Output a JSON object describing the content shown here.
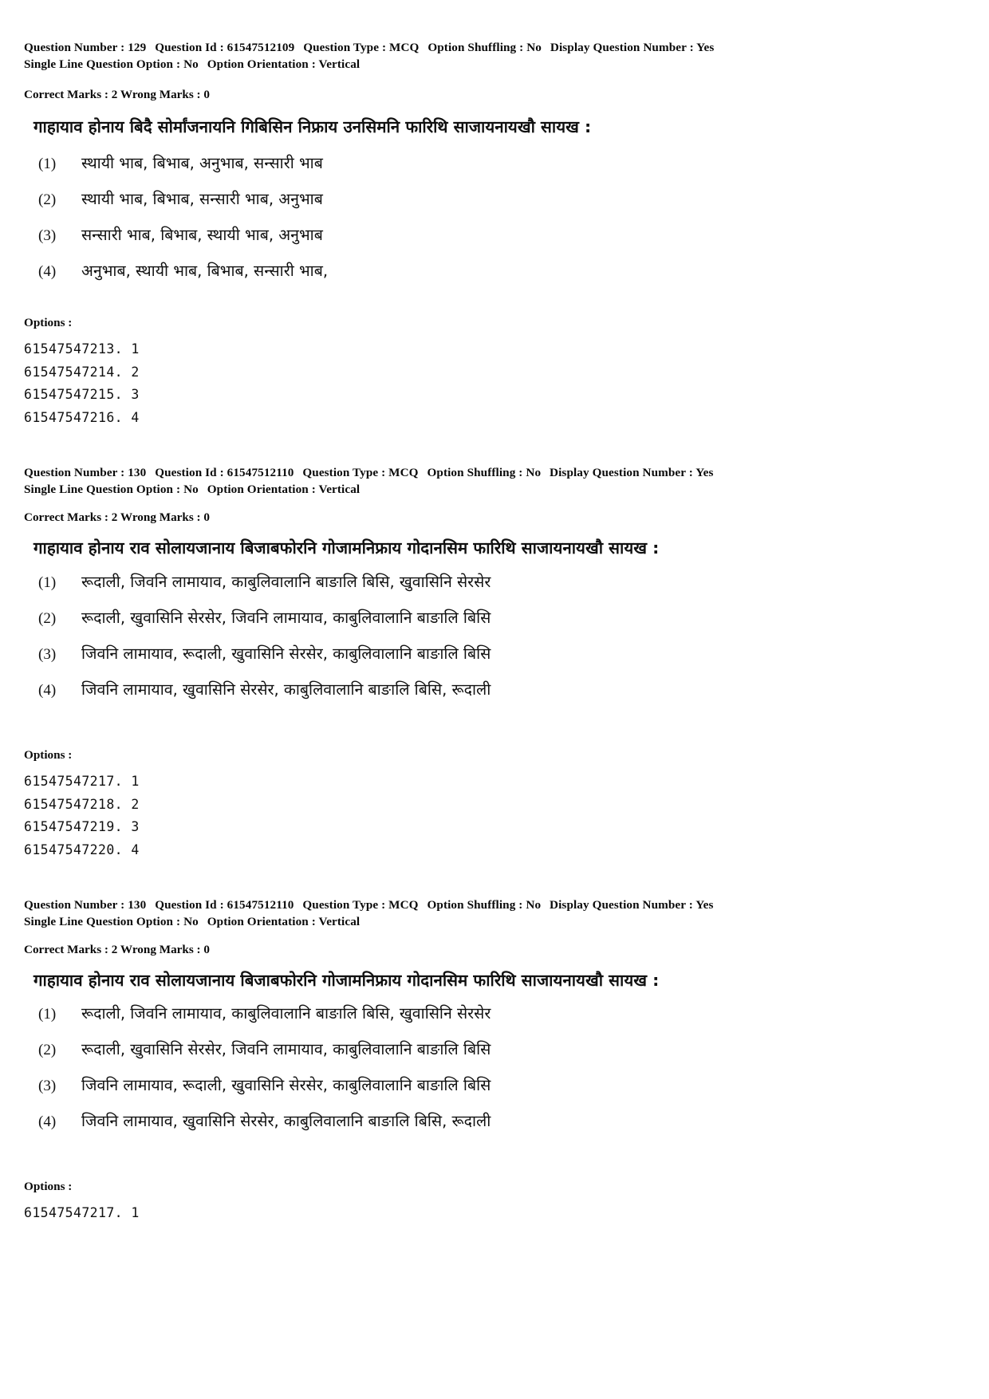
{
  "page": {
    "background": "#ffffff",
    "text_color": "#111111"
  },
  "labels": {
    "question_number": "Question Number :",
    "question_id": "Question Id :",
    "question_type": "Question Type :",
    "option_shuffling": "Option Shuffling :",
    "display_question_number": "Display Question Number :",
    "single_line_question_option": "Single Line Question Option :",
    "option_orientation": "Option Orientation :",
    "correct_marks": "Correct Marks :",
    "wrong_marks": "Wrong Marks :",
    "options_heading": "Options :"
  },
  "questions": [
    {
      "meta": {
        "question_number": "129",
        "question_id": "61547512109",
        "question_type": "MCQ",
        "option_shuffling": "No",
        "display_question_number": "Yes",
        "single_line_question_option": "No",
        "option_orientation": "Vertical",
        "correct_marks": "2",
        "wrong_marks": "0"
      },
      "stem": "गाहायाव होनाय बिदै सोर्मांजनायनि गिबिसिन निफ्राय उनसिमनि फारिथि साजायनायखौ सायख :",
      "choices": [
        {
          "num": "(1)",
          "text": "स्थायी भाब, बिभाब, अनुभाब, सन्सारी भाब"
        },
        {
          "num": "(2)",
          "text": "स्थायी भाब, बिभाब, सन्सारी भाब, अनुभाब"
        },
        {
          "num": "(3)",
          "text": "सन्सारी भाब, बिभाब, स्थायी भाब, अनुभाब"
        },
        {
          "num": "(4)",
          "text": "अनुभाब, स्थायी भाब, बिभाब, सन्सारी भाब,"
        }
      ],
      "option_ids": [
        "61547547213. 1",
        "61547547214. 2",
        "61547547215. 3",
        "61547547216. 4"
      ]
    },
    {
      "meta": {
        "question_number": "130",
        "question_id": "61547512110",
        "question_type": "MCQ",
        "option_shuffling": "No",
        "display_question_number": "Yes",
        "single_line_question_option": "No",
        "option_orientation": "Vertical",
        "correct_marks": "2",
        "wrong_marks": "0"
      },
      "stem": "गाहायाव होनाय राव सोलायजानाय बिजाबफोरनि गोजामनिफ्राय गोदानसिम फारिथि साजायनायखौ सायख :",
      "choices": [
        {
          "num": "(1)",
          "text": "रूदाली, जिवनि लामायाव, काबुलिवालानि बाङालि बिसि, खुवासिनि सेरसेर"
        },
        {
          "num": "(2)",
          "text": "रूदाली, खुवासिनि सेरसेर, जिवनि लामायाव, काबुलिवालानि बाङालि बिसि"
        },
        {
          "num": "(3)",
          "text": "जिवनि लामायाव, रूदाली, खुवासिनि सेरसेर, काबुलिवालानि बाङालि बिसि"
        },
        {
          "num": "(4)",
          "text": "जिवनि लामायाव, खुवासिनि सेरसेर, काबुलिवालानि बाङालि बिसि, रूदाली"
        }
      ],
      "option_ids": [
        "61547547217. 1",
        "61547547218. 2",
        "61547547219. 3",
        "61547547220. 4"
      ]
    },
    {
      "meta": {
        "question_number": "130",
        "question_id": "61547512110",
        "question_type": "MCQ",
        "option_shuffling": "No",
        "display_question_number": "Yes",
        "single_line_question_option": "No",
        "option_orientation": "Vertical",
        "correct_marks": "2",
        "wrong_marks": "0"
      },
      "stem": "गाहायाव होनाय राव सोलायजानाय बिजाबफोरनि गोजामनिफ्राय गोदानसिम फारिथि साजायनायखौ सायख :",
      "choices": [
        {
          "num": "(1)",
          "text": "रूदाली, जिवनि लामायाव, काबुलिवालानि बाङालि बिसि, खुवासिनि सेरसेर"
        },
        {
          "num": "(2)",
          "text": "रूदाली, खुवासिनि सेरसेर, जिवनि लामायाव, काबुलिवालानि बाङालि बिसि"
        },
        {
          "num": "(3)",
          "text": "जिवनि लामायाव, रूदाली, खुवासिनि सेरसेर, काबुलिवालानि बाङालि बिसि"
        },
        {
          "num": "(4)",
          "text": "जिवनि लामायाव, खुवासिनि सेरसेर, काबुलिवालानि बाङालि बिसि, रूदाली"
        }
      ],
      "option_ids": [
        "61547547217. 1"
      ]
    }
  ]
}
